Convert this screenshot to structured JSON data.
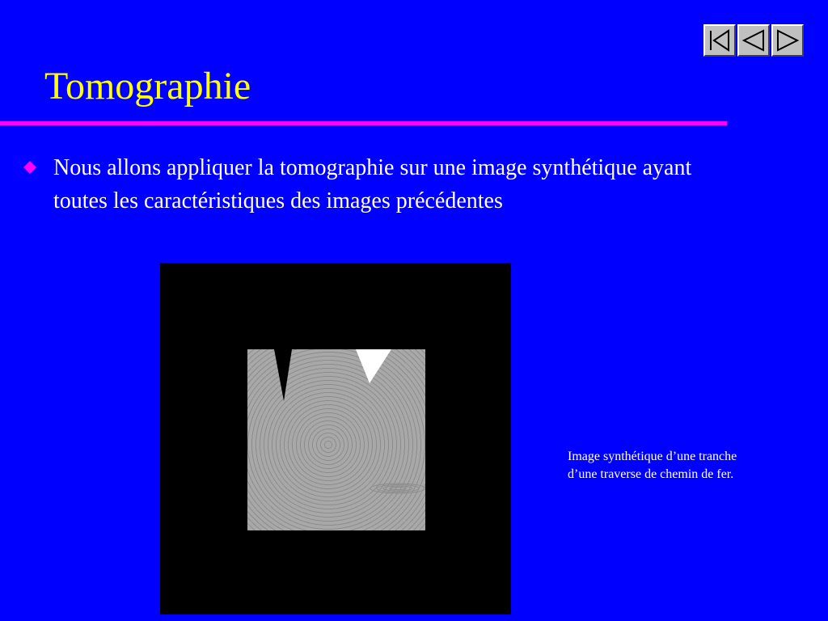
{
  "slide": {
    "title": "Tomographie",
    "bullets": [
      "Nous allons appliquer la tomographie sur une image synthétique ayant toutes les caractéristiques des images précédentes"
    ],
    "caption_lines": [
      "Image synthétique d’une tranche",
      "d’une traverse de chemin de fer."
    ]
  },
  "navigation": {
    "buttons": [
      {
        "icon": "first-slide-icon"
      },
      {
        "icon": "previous-slide-icon"
      },
      {
        "icon": "next-slide-icon"
      }
    ]
  },
  "colors": {
    "background": "#0000ff",
    "title": "#ffff00",
    "rule": "#ff00ff",
    "bullet": "#ff00ff",
    "text": "#ffffff"
  }
}
